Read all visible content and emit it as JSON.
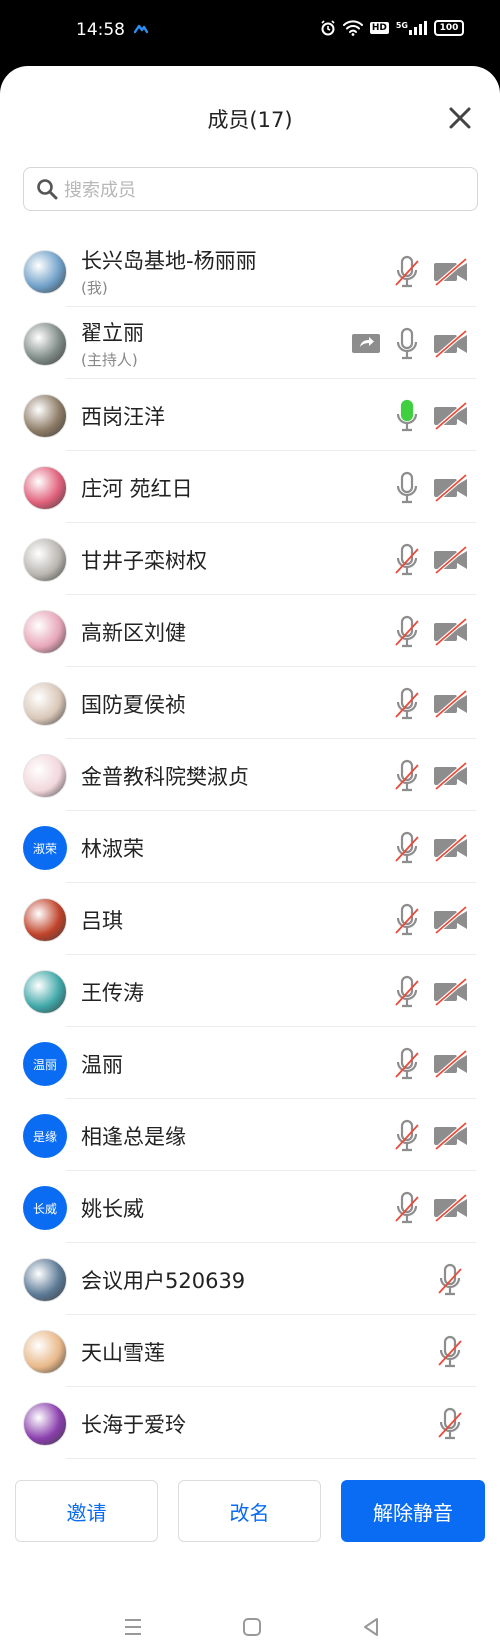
{
  "status_bar": {
    "time": "14:58",
    "hd": "HD",
    "network": "5G",
    "battery": "100"
  },
  "header": {
    "title": "成员(17)"
  },
  "search": {
    "placeholder": "搜索成员"
  },
  "members": [
    {
      "name": "长兴岛基地-杨丽丽",
      "sub": "(我)",
      "avatar": "photo",
      "avatar_color": "#6fa0c8",
      "mic": "muted",
      "camera": "off"
    },
    {
      "name": "翟立丽",
      "sub": "(主持人)",
      "avatar": "photo",
      "avatar_color": "#7f8b86",
      "share": true,
      "mic": "on",
      "camera": "off"
    },
    {
      "name": "西岗汪洋",
      "avatar": "photo",
      "avatar_color": "#8d7b66",
      "mic": "speaking",
      "camera": "off"
    },
    {
      "name": "庄河  苑红日",
      "avatar": "photo",
      "avatar_color": "#e0607a",
      "mic": "on",
      "camera": "off"
    },
    {
      "name": "甘井子栾树权",
      "avatar": "photo",
      "avatar_color": "#b9b6b0",
      "mic": "muted",
      "camera": "off"
    },
    {
      "name": "高新区刘健",
      "avatar": "photo",
      "avatar_color": "#e7a6b8",
      "mic": "muted",
      "camera": "off"
    },
    {
      "name": "国防夏侯祯",
      "avatar": "photo",
      "avatar_color": "#d9c7b8",
      "mic": "muted",
      "camera": "off"
    },
    {
      "name": "金普教科院樊淑贞",
      "avatar": "photo",
      "avatar_color": "#f2d7dc",
      "mic": "muted",
      "camera": "off"
    },
    {
      "name": "林淑荣",
      "avatar": "text",
      "avatar_text": "淑荣",
      "mic": "muted",
      "camera": "off"
    },
    {
      "name": "吕琪",
      "avatar": "photo",
      "avatar_color": "#c0432a",
      "mic": "muted",
      "camera": "off"
    },
    {
      "name": "王传涛",
      "avatar": "photo",
      "avatar_color": "#3fa7a8",
      "mic": "muted",
      "camera": "off"
    },
    {
      "name": "温丽",
      "avatar": "text",
      "avatar_text": "温丽",
      "mic": "muted",
      "camera": "off"
    },
    {
      "name": "相逢总是缘",
      "avatar": "text",
      "avatar_text": "是缘",
      "mic": "muted",
      "camera": "off"
    },
    {
      "name": "姚长威",
      "avatar": "text",
      "avatar_text": "长威",
      "mic": "muted",
      "camera": "off"
    },
    {
      "name": "会议用户520639",
      "avatar": "photo",
      "avatar_color": "#5c7a96",
      "mic": "muted",
      "camera": "none"
    },
    {
      "name": "天山雪莲",
      "avatar": "photo",
      "avatar_color": "#e9b98a",
      "mic": "muted",
      "camera": "none"
    },
    {
      "name": "长海于爱玲",
      "avatar": "photo",
      "avatar_color": "#8a3fae",
      "mic": "muted",
      "camera": "none"
    }
  ],
  "buttons": {
    "invite": "邀请",
    "rename": "改名",
    "unmute_all": "解除静音"
  },
  "colors": {
    "accent": "#0a6cf2",
    "speaking": "#3fcf3f",
    "muted_slash": "#e84c3d",
    "icon_gray": "#8d8d8d"
  }
}
